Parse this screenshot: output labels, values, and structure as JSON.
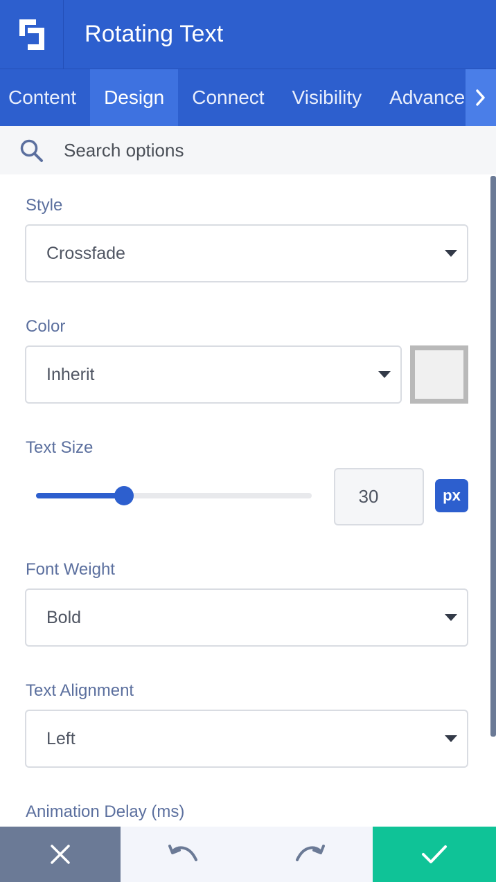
{
  "header": {
    "title": "Rotating Text",
    "logo_icon": "builder-logo-icon"
  },
  "tabs": [
    {
      "label": "Content",
      "active": false
    },
    {
      "label": "Design",
      "active": true
    },
    {
      "label": "Connect",
      "active": false
    },
    {
      "label": "Visibility",
      "active": false
    },
    {
      "label": "Advanced",
      "active": false
    }
  ],
  "search": {
    "placeholder": "Search options",
    "value": ""
  },
  "fields": {
    "style": {
      "label": "Style",
      "value": "Crossfade"
    },
    "color": {
      "label": "Color",
      "value": "Inherit",
      "swatch_color": "#f0f0f0"
    },
    "text_size": {
      "label": "Text Size",
      "value": "30",
      "unit": "px",
      "slider_fraction": 0.32
    },
    "font_weight": {
      "label": "Font Weight",
      "value": "Bold"
    },
    "text_alignment": {
      "label": "Text Alignment",
      "value": "Left"
    },
    "animation_delay": {
      "label": "Animation Delay (ms)"
    }
  },
  "colors": {
    "primary": "#2d5fce",
    "save": "#0fc397",
    "close": "#6b7a96",
    "label": "#5b6f9e"
  }
}
